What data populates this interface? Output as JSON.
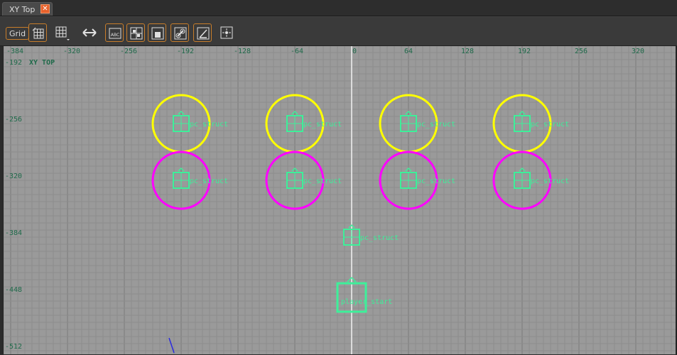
{
  "tab": {
    "title": "XY Top",
    "close_glyph": "✕"
  },
  "toolbar": {
    "grid_label": "Grid",
    "buttons": [
      {
        "icon": "grid-settings-icon",
        "active": true
      },
      {
        "icon": "grid-dropdown-icon",
        "active": false
      },
      {
        "icon": "expand-horizontal-icon",
        "active": false
      },
      {
        "icon": "text-labels-icon",
        "active": true
      },
      {
        "icon": "entity-connections-icon",
        "active": true
      },
      {
        "icon": "entity-boxes-icon",
        "active": true
      },
      {
        "icon": "link-icon",
        "active": true
      },
      {
        "icon": "angle-icon",
        "active": true
      },
      {
        "icon": "center-origin-icon",
        "active": false
      }
    ]
  },
  "viewport": {
    "view_label": "XY TOP",
    "x_ticks": [
      "-384",
      "-320",
      "-256",
      "-192",
      "-128",
      "-64",
      "0",
      "64",
      "128",
      "192",
      "256",
      "320"
    ],
    "y_ticks": [
      "-192",
      "-256",
      "-320",
      "-384",
      "-448",
      "-512"
    ],
    "colors": {
      "background": "#9a9a9a",
      "minor_grid": "#8c8c8c",
      "major_grid": "#7a7a7a",
      "origin_axis": "#dcdcdc",
      "entity": "#3df09a",
      "yellow_ring": "#ffff00",
      "magenta_ring": "#ff00ff"
    },
    "entities": {
      "struct_label": "pc_struct",
      "start_label": "player_start"
    }
  }
}
